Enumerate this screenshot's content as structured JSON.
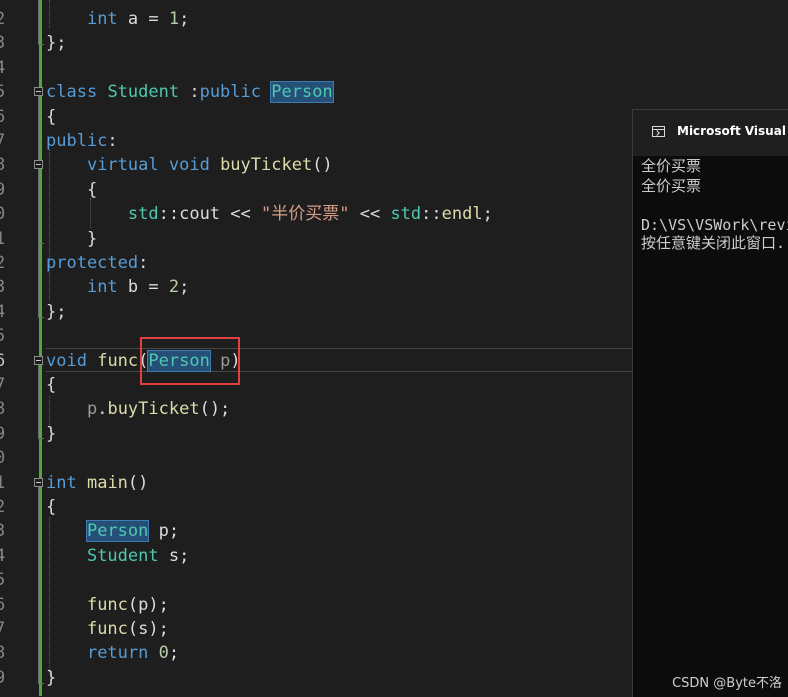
{
  "editor": {
    "line_numbers": [
      "2",
      "3",
      "4",
      "5",
      "6",
      "7",
      "8",
      "9",
      "0",
      "1",
      "2",
      "3",
      "4",
      "5",
      "6",
      "7",
      "8",
      "9",
      "0",
      "1",
      "2",
      "3",
      "4",
      "5",
      "6",
      "7",
      "8",
      "9"
    ],
    "lines": {
      "l02": {
        "t1": "int",
        "t2": " a = ",
        "t3": "1",
        "t4": ";"
      },
      "l03": {
        "t1": "};"
      },
      "l05": {
        "t1": "class",
        "t2": " ",
        "t3": "Student",
        "t4": " :",
        "t5": "public",
        "t6": " ",
        "t7": "Person"
      },
      "l06": {
        "t1": "{"
      },
      "l07": {
        "t1": "public",
        "t2": ":"
      },
      "l08": {
        "t1": "virtual",
        "t2": " ",
        "t3": "void",
        "t4": " ",
        "t5": "buyTicket",
        "t6": "()"
      },
      "l09": {
        "t1": "{"
      },
      "l10": {
        "t1": "std",
        "t2": "::",
        "t3": "cout",
        "t4": " << ",
        "t5": "\"半价买票\"",
        "t6": " << ",
        "t7": "std",
        "t8": "::",
        "t9": "endl",
        "t10": ";"
      },
      "l11": {
        "t1": "}"
      },
      "l12": {
        "t1": "protected",
        "t2": ":"
      },
      "l13": {
        "t1": "int",
        "t2": " b = ",
        "t3": "2",
        "t4": ";"
      },
      "l14": {
        "t1": "};"
      },
      "l16": {
        "t1": "void",
        "t2": " ",
        "t3": "func",
        "t4": "(",
        "t5": "Person",
        "t6": " ",
        "t7": "p",
        "t8": ")"
      },
      "l17": {
        "t1": "{"
      },
      "l18": {
        "t1": "p",
        "t2": ".",
        "t3": "buyTicket",
        "t4": "();"
      },
      "l19": {
        "t1": "}"
      },
      "l21": {
        "t1": "int",
        "t2": " ",
        "t3": "main",
        "t4": "()"
      },
      "l22": {
        "t1": "{"
      },
      "l23": {
        "t1": "Person",
        "t2": " p;"
      },
      "l24": {
        "t1": "Student",
        "t2": " s;"
      },
      "l26": {
        "t1": "func",
        "t2": "(p);"
      },
      "l27": {
        "t1": "func",
        "t2": "(s);"
      },
      "l28": {
        "t1": "return",
        "t2": " ",
        "t3": "0",
        "t4": ";"
      },
      "l29": {
        "t1": "}"
      }
    }
  },
  "console": {
    "title": "Microsoft Visual Studio Debug Console",
    "lines": [
      "全价买票",
      "全价买票",
      "",
      "D:\\VS\\VSWork\\review",
      "按任意键关闭此窗口..."
    ]
  },
  "watermark": "CSDN @Byte不洛",
  "colors": {
    "background": "#1e1e1e",
    "keyword": "#569cd6",
    "type": "#4ec9b0",
    "function": "#dcdcaa",
    "number": "#b5cea8",
    "string": "#d69d85",
    "change_bar": "#53a63f",
    "annotation_box": "#e0403f",
    "console_background": "#0c0c0c"
  }
}
